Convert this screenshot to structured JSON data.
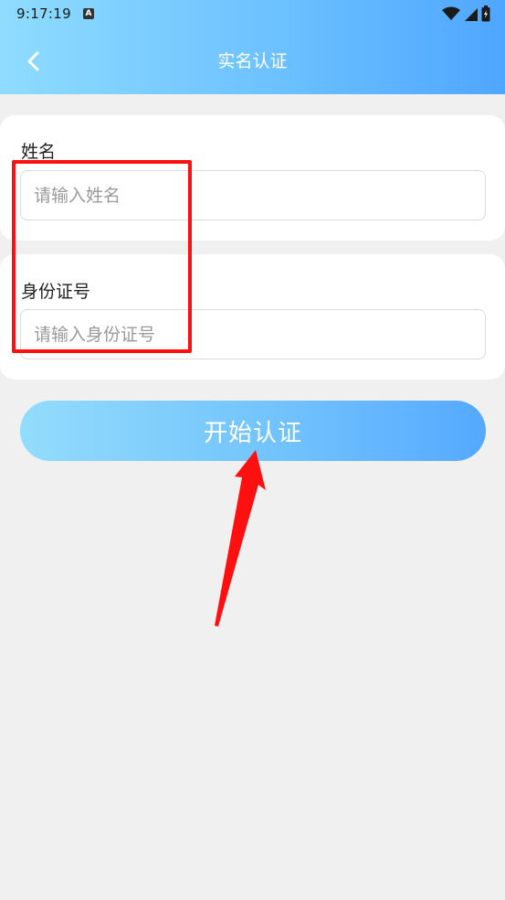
{
  "status_bar": {
    "time": "9:17:19",
    "notification_badge": "A"
  },
  "navbar": {
    "title": "实名认证",
    "back_icon": "chevron-left-icon"
  },
  "form": {
    "name": {
      "label": "姓名",
      "value": "",
      "placeholder": "请输入姓名"
    },
    "id_number": {
      "label": "身份证号",
      "value": "",
      "placeholder": "请输入身份证号"
    },
    "submit_label": "开始认证"
  },
  "colors": {
    "header_gradient_start": "#8fdcff",
    "header_gradient_end": "#4fa6ff",
    "page_background": "#f0f0f0",
    "annotation_red": "#ff1010"
  }
}
